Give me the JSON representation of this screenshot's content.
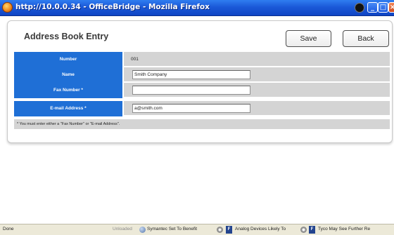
{
  "window": {
    "title": "http://10.0.0.34 - OfficeBridge - Mozilla Firefox"
  },
  "page": {
    "heading": "Address Book Entry",
    "save_label": "Save",
    "back_label": "Back"
  },
  "form": {
    "number_label": "Number",
    "number_value": "001",
    "name_label": "Name",
    "name_value": "Smith Company",
    "fax_label": "Fax Number *",
    "fax_value": "",
    "email_label": "E-mail Address *",
    "email_value": "a@smith.com",
    "note": "* You must enter either a \"Fax Number\" or \"E-mail Address\"."
  },
  "statusbar": {
    "status": "Done",
    "unloaded": "Unloaded",
    "news_items": [
      "Symantec Set To Benefit",
      "Analog Devices Likely To",
      "Tyco May See Further Re"
    ]
  },
  "colors": {
    "titlebar": "#1b59d8",
    "label_background": "#1f6fd6",
    "row_background": "#d4d4d4"
  }
}
